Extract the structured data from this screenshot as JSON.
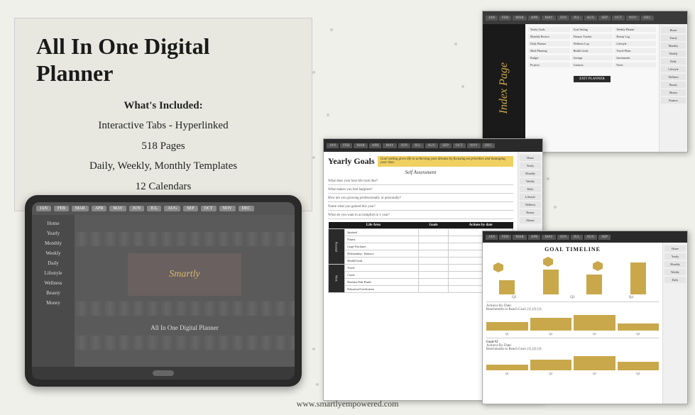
{
  "page": {
    "background_color": "#f0f0ea",
    "footer_url": "www.smartlyempowered.com"
  },
  "left_panel": {
    "title": "All In One Digital Planner",
    "subtitle_label": "What's Included:",
    "features": [
      "Interactive Tabs - Hyperlinked",
      "518 Pages",
      "Daily, Weekly, Monthly Templates",
      "12 Calendars"
    ]
  },
  "tablet": {
    "logo_text": "Smartly",
    "label": "All In One Digital Planner",
    "tabs": [
      "JAN",
      "FEB",
      "MAR",
      "APR",
      "MAY",
      "JUN",
      "JUL",
      "AUG",
      "SEP",
      "OCT",
      "NOV",
      "DEC"
    ],
    "sidebar_items": [
      "Home",
      "Yearly",
      "Monthly",
      "Weekly",
      "Daily",
      "Lifestyle",
      "Wellness",
      "Beauty",
      "Money"
    ]
  },
  "index_page": {
    "title": "Index Page",
    "tabs": [
      "JAN",
      "FEB",
      "MAR",
      "APR",
      "MAY",
      "JUN",
      "JUL",
      "AUG",
      "SEP",
      "OCT",
      "NOV",
      "DEC"
    ],
    "sidebar_items": [
      "Home",
      "Yearly",
      "Monthly",
      "Weekly",
      "Daily",
      "Lifestyle",
      "Wellness",
      "Beauty",
      "Money",
      "Finance"
    ]
  },
  "yearly_goals": {
    "title": "Yearly Goals",
    "tagline": "Goal setting gives life to achieving your dreams by focusing on priorities and managing your time.",
    "section_title": "Self Assessment",
    "questions": [
      "What does your best life look like?",
      "What makes you feel happiest?",
      "How are you growing professionally or personally?",
      "Name what you gained this year?",
      "What do you want to accomplish in 1 year?"
    ],
    "table": {
      "headers": [
        "Life Area",
        "Goals",
        "Actions by date"
      ],
      "categories": [
        "Personal",
        "Work"
      ],
      "rows": [
        [
          "Spiritual"
        ],
        [
          "Fitness"
        ],
        [
          "Large Purchases"
        ],
        [
          "Relationship / Intimacy"
        ],
        [
          "Health/Goals"
        ],
        [
          "Travel"
        ],
        [
          "Career"
        ],
        [
          "Business/Side Hustle"
        ],
        [
          "Education/Certification"
        ]
      ]
    },
    "sidebar_items": [
      "Home",
      "Yearly",
      "Monthly",
      "Weekly",
      "Daily",
      "Lifestyle",
      "Wellness",
      "Beauty",
      "Money"
    ]
  },
  "goal_timeline": {
    "title": "GOAL TIMELINE",
    "milestones": [
      {
        "label": "(1)",
        "quarter": "Q1"
      },
      {
        "label": "(2)",
        "quarter": "Q2"
      },
      {
        "label": "(3)",
        "quarter": "Q3"
      }
    ],
    "quarters": [
      "Q1",
      "Q2",
      "Q3",
      "Q4"
    ],
    "goal1": {
      "achieve_label": "Achieve By Date:",
      "benchmarks_label": "Benchmarks to Reach Goal:",
      "values": [
        "(1)",
        "(2)",
        "(3)"
      ],
      "quarters": [
        "Q1",
        "Q2",
        "Q3",
        "Q4"
      ]
    },
    "goal2": {
      "achieve_label": "Goal #2",
      "achieve_sub": "Achieve By Date:",
      "benchmarks_label": "Benchmarks to Reach Goal:",
      "values": [
        "(1)",
        "(2)",
        "(3)"
      ],
      "quarters": [
        "Q1",
        "Q2",
        "Q3",
        "Q4"
      ]
    },
    "sidebar_items": [
      "Home",
      "Yearly",
      "Monthly",
      "Weekly",
      "Daily"
    ]
  }
}
